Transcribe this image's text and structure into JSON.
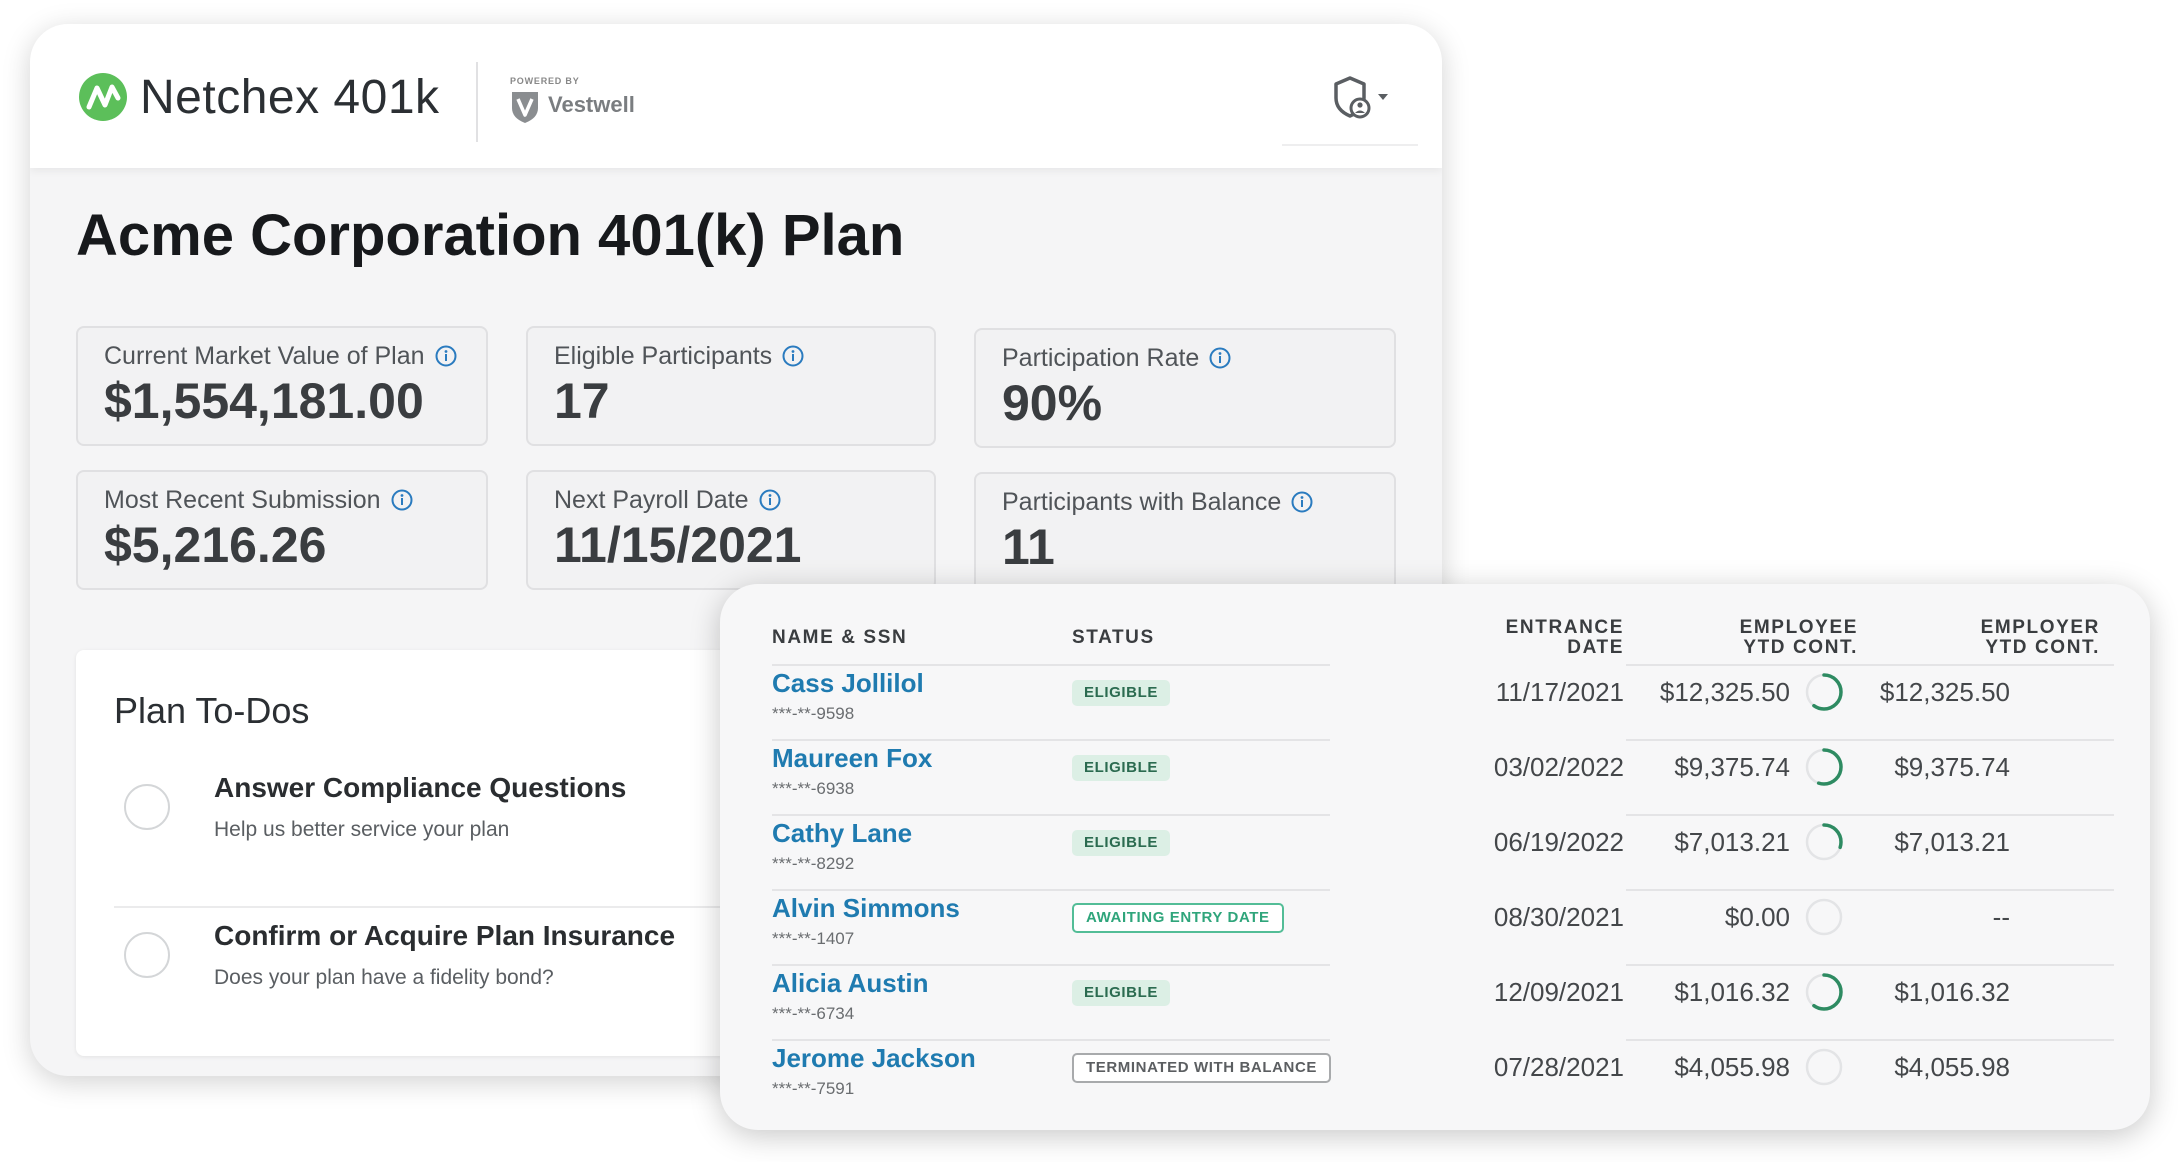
{
  "header": {
    "brand": "Netchex 401k",
    "powered_by": "POWERED BY",
    "partner": "Vestwell"
  },
  "colors": {
    "brand_green": "#5cbf5a",
    "link_blue": "#1f7bb0",
    "ring_green": "#2e8b62",
    "eligible_bg": "#dcefe5"
  },
  "page_title": "Acme Corporation 401(k) Plan",
  "stats": [
    {
      "label": "Current Market Value of Plan",
      "value": "$1,554,181.00",
      "icon": "info-icon"
    },
    {
      "label": "Eligible Participants",
      "value": "17",
      "icon": "info-icon"
    },
    {
      "label": "Participation Rate",
      "value": "90%",
      "icon": "info-icon"
    },
    {
      "label": "Most Recent Submission",
      "value": "$5,216.26",
      "icon": "info-icon"
    },
    {
      "label": "Next Payroll Date",
      "value": "11/15/2021",
      "icon": "info-icon"
    },
    {
      "label": "Participants with Balance",
      "value": "11",
      "icon": "info-icon"
    }
  ],
  "todos": {
    "title": "Plan To-Dos",
    "items": [
      {
        "title": "Answer Compliance Questions",
        "subtitle": "Help us better service your plan"
      },
      {
        "title": "Confirm or Acquire Plan Insurance",
        "subtitle": "Does your plan have a fidelity bond?"
      }
    ]
  },
  "table": {
    "columns": {
      "name": "NAME & SSN",
      "status": "STATUS",
      "entrance_l1": "ENTRANCE",
      "entrance_l2": "DATE",
      "employee_l1": "EMPLOYEE",
      "employee_l2": "YTD CONT.",
      "employer_l1": "EMPLOYER",
      "employer_l2": "YTD CONT."
    },
    "rows": [
      {
        "name": "Cass Jollilol",
        "ssn": "***-**-9598",
        "status": "ELIGIBLE",
        "entrance": "11/17/2021",
        "employee": "$12,325.50",
        "employer": "$12,325.50",
        "progress": 0.6
      },
      {
        "name": "Maureen Fox",
        "ssn": "***-**-6938",
        "status": "ELIGIBLE",
        "entrance": "03/02/2022",
        "employee": "$9,375.74",
        "employer": "$9,375.74",
        "progress": 0.55
      },
      {
        "name": "Cathy Lane",
        "ssn": "***-**-8292",
        "status": "ELIGIBLE",
        "entrance": "06/19/2022",
        "employee": "$7,013.21",
        "employer": "$7,013.21",
        "progress": 0.3
      },
      {
        "name": "Alvin Simmons",
        "ssn": "***-**-1407",
        "status": "AWAITING ENTRY DATE",
        "entrance": "08/30/2021",
        "employee": "$0.00",
        "employer": "--",
        "progress": 0
      },
      {
        "name": "Alicia Austin",
        "ssn": "***-**-6734",
        "status": "ELIGIBLE",
        "entrance": "12/09/2021",
        "employee": "$1,016.32",
        "employer": "$1,016.32",
        "progress": 0.6
      },
      {
        "name": "Jerome Jackson",
        "ssn": "***-**-7591",
        "status": "TERMINATED WITH BALANCE",
        "entrance": "07/28/2021",
        "employee": "$4,055.98",
        "employer": "$4,055.98",
        "progress": 0
      }
    ]
  }
}
